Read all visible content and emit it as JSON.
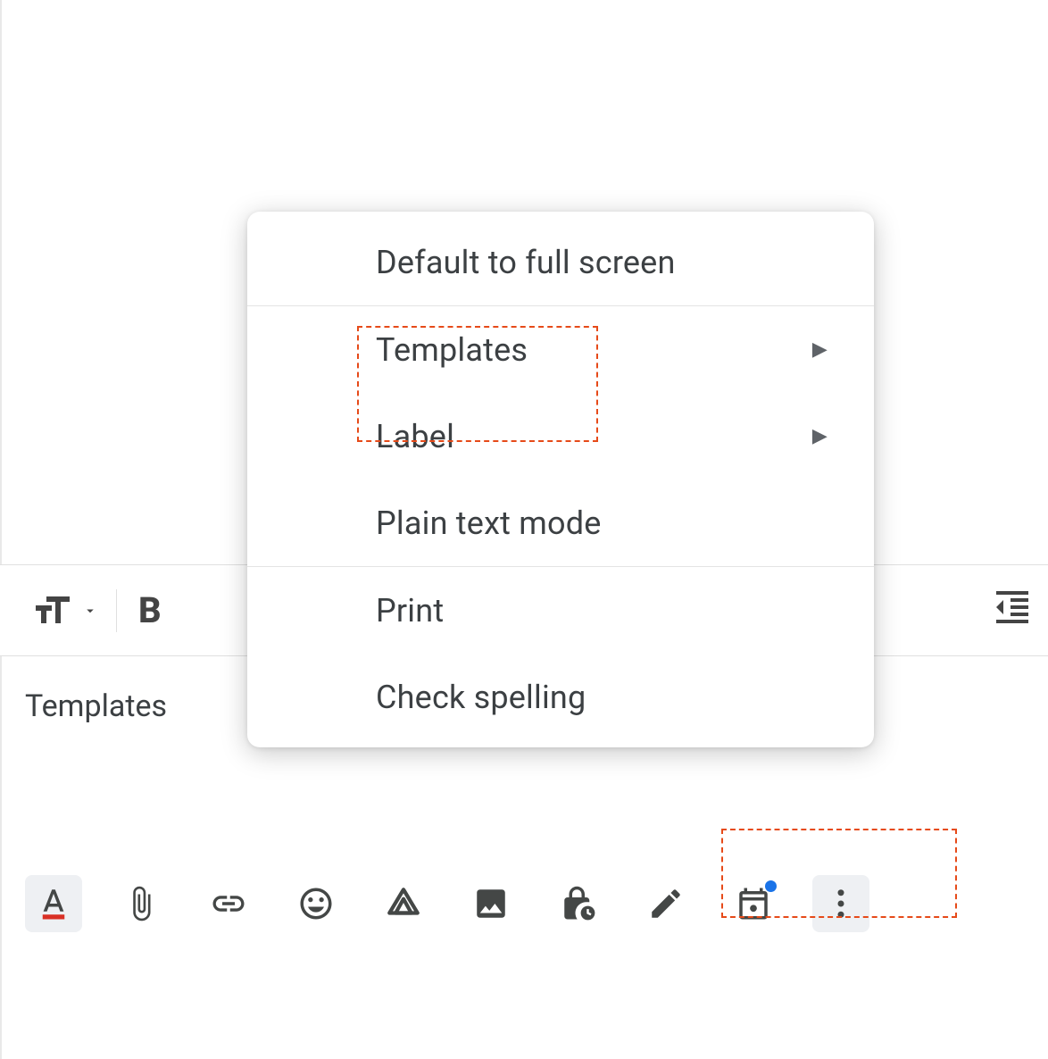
{
  "toolbar": {
    "text_size_label": "Text size",
    "bold_label": "B"
  },
  "menu": {
    "items": [
      {
        "label": "Default to full screen",
        "hasSubmenu": false
      },
      {
        "label": "Templates",
        "hasSubmenu": true
      },
      {
        "label": "Label",
        "hasSubmenu": true
      },
      {
        "label": "Plain text mode",
        "hasSubmenu": false
      },
      {
        "label": "Print",
        "hasSubmenu": false
      },
      {
        "label": "Check spelling",
        "hasSubmenu": false
      }
    ]
  },
  "labels": {
    "templates": "Templates"
  },
  "icons": {
    "format": "A",
    "attach": "attach",
    "link": "link",
    "emoji": "emoji",
    "drive": "drive",
    "image": "image",
    "confidential": "lock-clock",
    "signature": "pen",
    "schedule": "calendar",
    "more": "more"
  }
}
